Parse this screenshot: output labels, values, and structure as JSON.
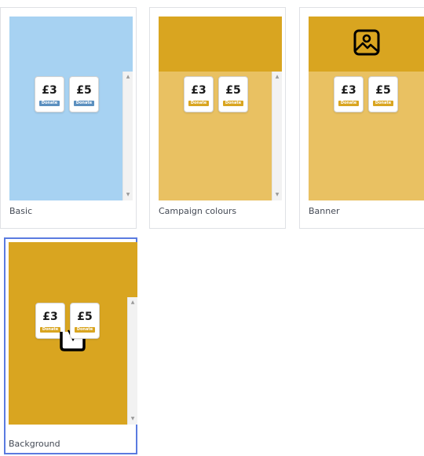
{
  "templates": [
    {
      "label": "Basic",
      "preview_bg": "#a7d2f2",
      "tile_bg": "#ffffff",
      "button_color": "#5b8fbf",
      "amounts": [
        "£3",
        "£5"
      ],
      "button_label": "Donate",
      "selected": false
    },
    {
      "label": "Campaign colours",
      "preview_bg": "#e9c162",
      "top_color": "#d9a520",
      "tile_bg": "#ffffff",
      "button_color": "#d9a520",
      "amounts": [
        "£3",
        "£5"
      ],
      "button_label": "Donate",
      "selected": false
    },
    {
      "label": "Banner",
      "preview_bg": "#e9c162",
      "banner_color": "#d9a520",
      "banner_icon": "image-icon",
      "tile_bg": "#ffffff",
      "button_color": "#d9a520",
      "amounts": [
        "£3",
        "£5"
      ],
      "button_label": "Donate",
      "selected": false
    },
    {
      "label": "Background",
      "preview_bg": "#d9a520",
      "tile_bg": "#ffffff",
      "button_color": "#d9a520",
      "amounts": [
        "£3",
        "£5"
      ],
      "button_label": "Donate",
      "selected": true
    }
  ],
  "selection_color": "#5a7be0",
  "drag_cursor_icon": "drag-hand-cursor-icon"
}
